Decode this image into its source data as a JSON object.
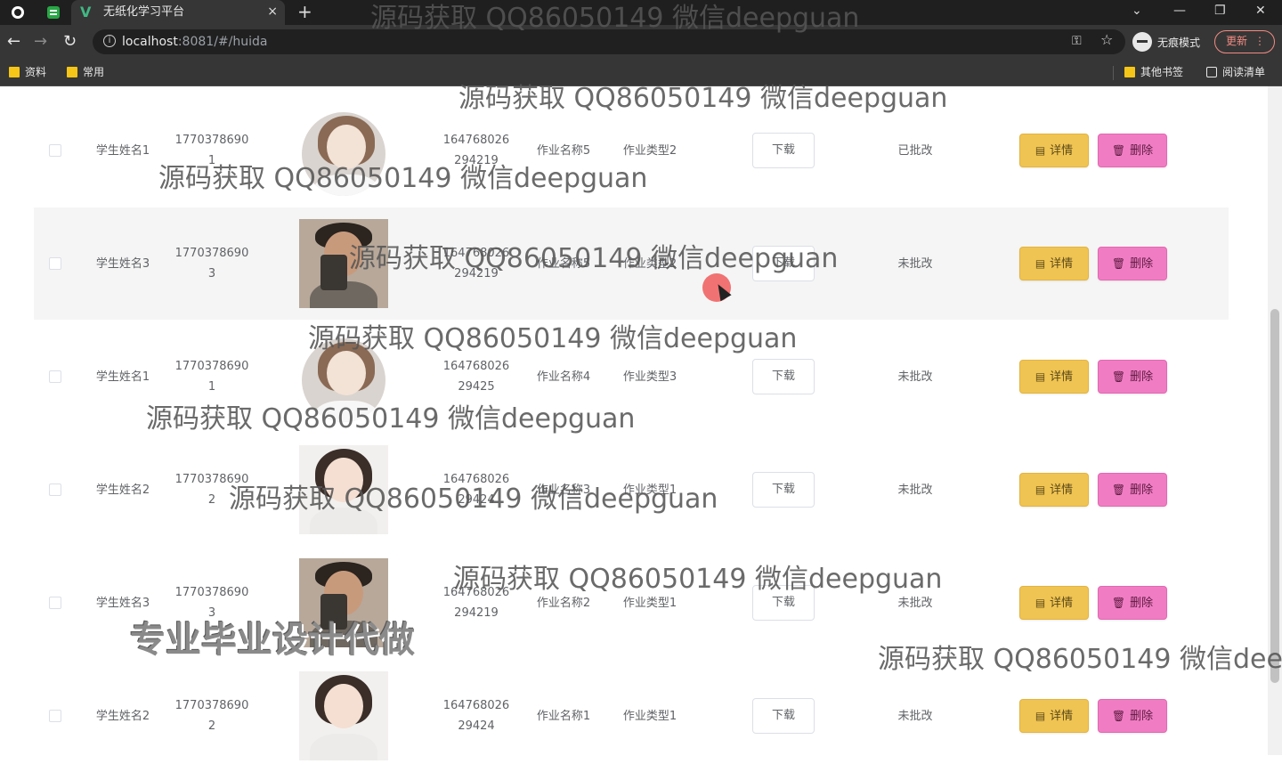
{
  "browser": {
    "tab_title": "无纸化学习平台",
    "tab_close": "×",
    "new_tab": "+",
    "url_host": "localhost",
    "url_rest": ":8081/#/huida",
    "incognito_label": "无痕模式",
    "update_label": "更新",
    "bookmarks": [
      "资料",
      "常用"
    ],
    "other_bookmarks": "其他书签",
    "reading_list": "阅读清单"
  },
  "labels": {
    "download": "下载",
    "detail": "详情",
    "delete": "删除"
  },
  "rows": [
    {
      "name": "学生姓名1",
      "id": "17703786901",
      "submit_time": "164768026294219",
      "homework_name": "作业名称5",
      "homework_type": "作业类型2",
      "status": "已批改",
      "avatar": "cartoon-girl",
      "highlighted": false
    },
    {
      "name": "学生姓名3",
      "id": "17703786903",
      "submit_time": "164768026294219",
      "homework_name": "作业名称5",
      "homework_type": "作业类型2",
      "status": "未批改",
      "avatar": "man-selfie",
      "highlighted": true
    },
    {
      "name": "学生姓名1",
      "id": "17703786901",
      "submit_time": "16476802629425",
      "homework_name": "作业名称4",
      "homework_type": "作业类型3",
      "status": "未批改",
      "avatar": "cartoon-girl",
      "highlighted": false
    },
    {
      "name": "学生姓名2",
      "id": "17703786902",
      "submit_time": "16476802629424",
      "homework_name": "作业名称3",
      "homework_type": "作业类型1",
      "status": "未批改",
      "avatar": "woman-portrait",
      "highlighted": false
    },
    {
      "name": "学生姓名3",
      "id": "17703786903",
      "submit_time": "164768026294219",
      "homework_name": "作业名称2",
      "homework_type": "作业类型1",
      "status": "未批改",
      "avatar": "man-selfie",
      "highlighted": false
    },
    {
      "name": "学生姓名2",
      "id": "17703786902",
      "submit_time": "16476802629424",
      "homework_name": "作业名称1",
      "homework_type": "作业类型1",
      "status": "未批改",
      "avatar": "woman-portrait",
      "highlighted": false
    }
  ],
  "watermark": {
    "text": "源码获取 QQ86050149 微信deepguan",
    "text_cut": "源码获取 QQ86050149 微信deep",
    "promo": "专业毕业设计代做"
  },
  "colors": {
    "detail_button": "#f0c452",
    "delete_button": "#f07dc3",
    "row_highlight": "#f5f5f5"
  }
}
